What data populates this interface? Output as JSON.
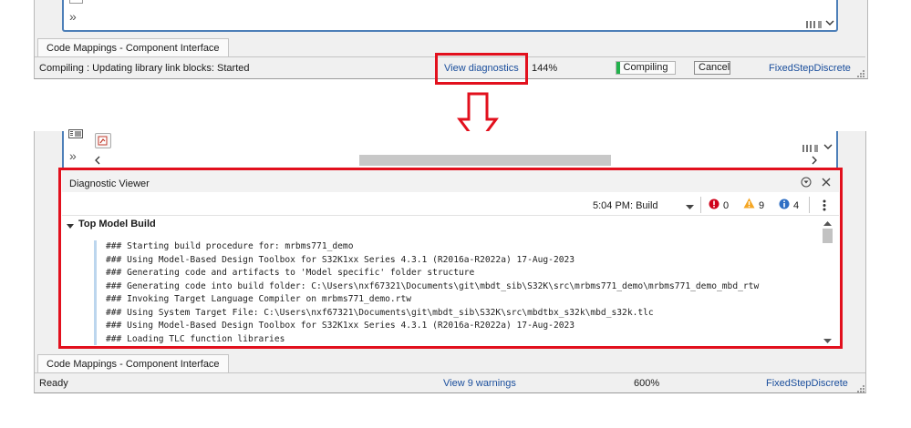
{
  "top_window": {
    "tab_label": "Code Mappings - Component Interface",
    "status_message": "Compiling : Updating library link blocks: Started",
    "view_diagnostics_link": "View diagnostics",
    "zoom": "144%",
    "progress_label": "Compiling",
    "progress_fraction": 0.07,
    "cancel_label": "Cancel",
    "solver": "FixedStepDiscrete"
  },
  "arrow_icon": "down-arrow-outline",
  "bottom_window": {
    "diagnostic_viewer": {
      "title": "Diagnostic Viewer",
      "build_selector": "5:04 PM: Build",
      "errors": "0",
      "warnings": "9",
      "info": "4",
      "section_title": "Top Model Build",
      "log_lines": [
        "### Starting build procedure for: mrbms771_demo",
        "### Using Model-Based Design Toolbox for S32K1xx Series 4.3.1 (R2016a-R2022a) 17-Aug-2023",
        "### Generating code and artifacts to 'Model specific' folder structure",
        "### Generating code into build folder: C:\\Users\\nxf67321\\Documents\\git\\mbdt_sib\\S32K\\src\\mrbms771_demo\\mrbms771_demo_mbd_rtw",
        "### Invoking Target Language Compiler on mrbms771_demo.rtw",
        "### Using System Target File: C:\\Users\\nxf67321\\Documents\\git\\mbdt_sib\\S32K\\src\\mbdtbx_s32k\\mbd_s32k.tlc",
        "### Using Model-Based Design Toolbox for S32K1xx Series 4.3.1 (R2016a-R2022a) 17-Aug-2023",
        "### Loading TLC function libraries"
      ]
    },
    "tab_label": "Code Mappings - Component Interface",
    "status_message": "Ready",
    "warnings_link": "View 9 warnings",
    "zoom": "600%",
    "solver": "FixedStepDiscrete"
  },
  "colors": {
    "highlight": "#e2101d",
    "link": "#1a4e9c",
    "progress_green": "#22b14c",
    "error_red": "#d0021b",
    "warning_orange": "#f5a623",
    "info_blue": "#2f6fc4",
    "canvas_border": "#4d7fb8"
  }
}
